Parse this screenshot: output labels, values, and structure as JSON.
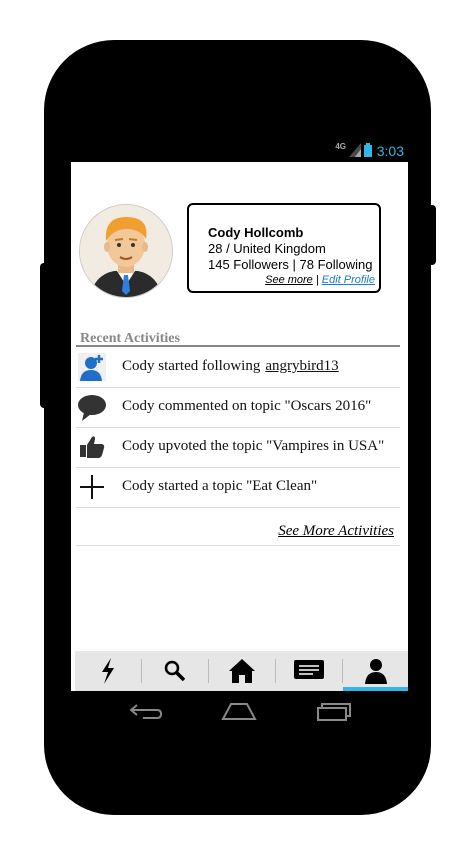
{
  "statusbar": {
    "network": "4G",
    "time": "3:03",
    "time_color": "#33b5e5"
  },
  "profile": {
    "name": "Cody Hollcomb",
    "age_location": "28 / United Kingdom",
    "stats": "145 Followers | 78 Following",
    "see_more_label": "See more",
    "separator": "|",
    "edit_profile_label": "Edit Profile",
    "edit_link_color": "#1a7bd0"
  },
  "recent": {
    "title": "Recent Activities",
    "items": [
      {
        "icon": "user-follow-icon",
        "text": "Cody started following",
        "link": "angrybird13"
      },
      {
        "icon": "comment-icon",
        "text": "Cody commented on topic \"Oscars 2016\""
      },
      {
        "icon": "thumbs-up-icon",
        "text": "Cody upvoted  the topic \"Vampires in USA\""
      },
      {
        "icon": "plus-icon",
        "text": "Cody started a topic \"Eat Clean\""
      }
    ],
    "see_more_label": "See More Activities"
  },
  "tabs": [
    {
      "icon": "lightning-icon",
      "active": false
    },
    {
      "icon": "search-icon",
      "active": false
    },
    {
      "icon": "home-icon",
      "active": false
    },
    {
      "icon": "message-icon",
      "active": false
    },
    {
      "icon": "profile-icon",
      "active": true
    }
  ],
  "accent_color": "#33b5e5"
}
